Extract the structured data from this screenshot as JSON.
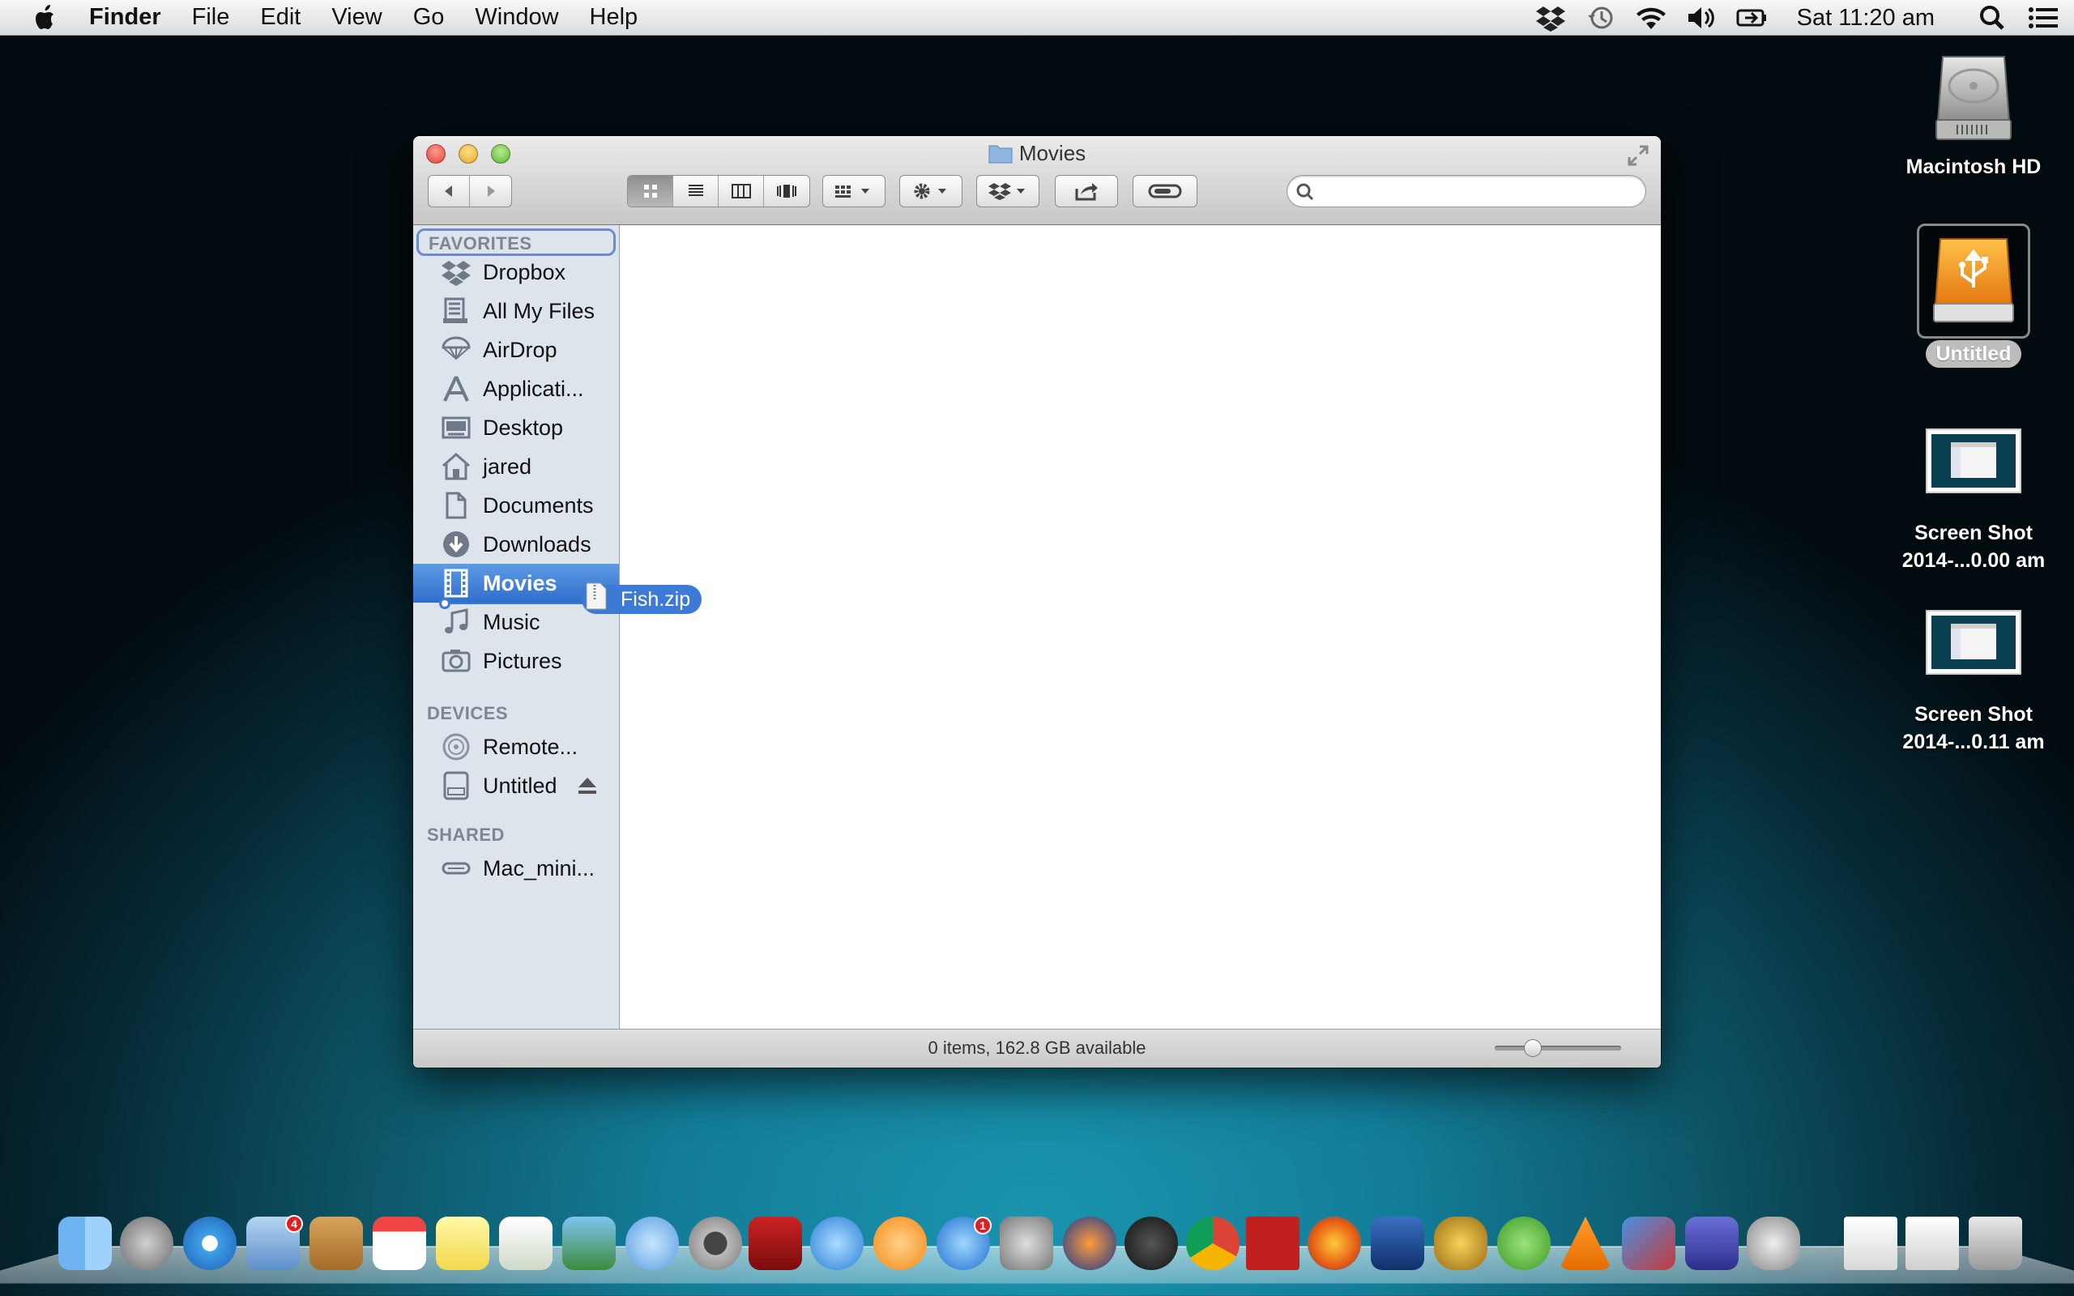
{
  "menubar": {
    "app_name": "Finder",
    "menus": [
      "File",
      "Edit",
      "View",
      "Go",
      "Window",
      "Help"
    ],
    "clock": "Sat 11:20 am",
    "status_icons": [
      "dropbox-icon",
      "time-machine-icon",
      "wifi-icon",
      "volume-icon",
      "battery-icon",
      "spotlight-icon",
      "notification-center-icon"
    ]
  },
  "desktop": {
    "items": [
      {
        "label": "Macintosh HD",
        "icon": "hard-drive-icon"
      },
      {
        "label": "Untitled",
        "icon": "usb-drive-icon",
        "selected": true
      },
      {
        "label_line1": "Screen Shot",
        "label_line2": "2014-...0.00 am",
        "icon": "screenshot-thumbnail-icon"
      },
      {
        "label_line1": "Screen Shot",
        "label_line2": "2014-...0.11 am",
        "icon": "screenshot-thumbnail-icon"
      }
    ]
  },
  "window": {
    "title": "Movies",
    "search_placeholder": "",
    "sidebar": {
      "favorites_header": "FAVORITES",
      "favorites": [
        {
          "label": "Dropbox",
          "icon": "dropbox-icon"
        },
        {
          "label": "All My Files",
          "icon": "all-files-icon"
        },
        {
          "label": "AirDrop",
          "icon": "airdrop-icon"
        },
        {
          "label": "Applicati...",
          "icon": "applications-icon"
        },
        {
          "label": "Desktop",
          "icon": "desktop-icon"
        },
        {
          "label": "jared",
          "icon": "home-icon"
        },
        {
          "label": "Documents",
          "icon": "documents-icon"
        },
        {
          "label": "Downloads",
          "icon": "downloads-icon"
        },
        {
          "label": "Movies",
          "icon": "movies-icon",
          "selected": true
        },
        {
          "label": "Music",
          "icon": "music-icon"
        },
        {
          "label": "Pictures",
          "icon": "pictures-icon"
        }
      ],
      "devices_header": "DEVICES",
      "devices": [
        {
          "label": "Remote...",
          "icon": "remote-disc-icon"
        },
        {
          "label": "Untitled",
          "icon": "external-disk-icon",
          "eject": true
        }
      ],
      "shared_header": "SHARED",
      "shared": [
        {
          "label": "Mac_mini...",
          "icon": "shared-computer-icon"
        }
      ]
    },
    "drag_item": "Fish.zip",
    "status": "0 items, 162.8 GB available"
  },
  "colors": {
    "selection_blue": "#3c7ad6",
    "sidebar_bg": "#dde4ec",
    "focus_ring": "#6d8ccf"
  }
}
